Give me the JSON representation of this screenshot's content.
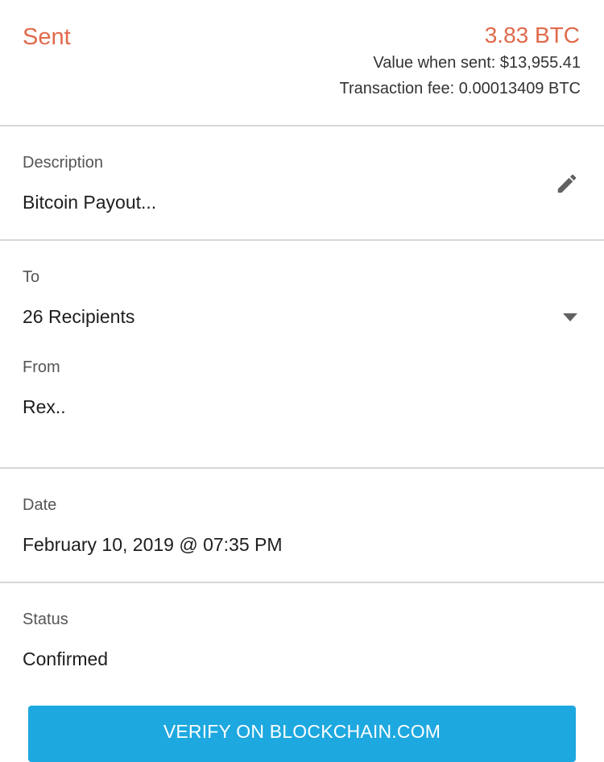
{
  "colors": {
    "sent_accent": "#e06a4c",
    "button_background": "#1ea8e0",
    "icon_gray": "#616161"
  },
  "summary": {
    "direction_label": "Sent",
    "amount": "3.83 BTC",
    "value_when_sent": "Value when sent: $13,955.41",
    "transaction_fee": "Transaction fee: 0.00013409 BTC"
  },
  "description": {
    "label": "Description",
    "value": "Bitcoin Payout...",
    "edit_icon": "pencil-icon"
  },
  "recipients": {
    "to_label": "To",
    "to_value": "26 Recipients",
    "dropdown_icon": "caret-down-icon",
    "from_label": "From",
    "from_value": "Rex.."
  },
  "date": {
    "label": "Date",
    "value": "February 10, 2019 @ 07:35 PM"
  },
  "status": {
    "label": "Status",
    "value": "Confirmed"
  },
  "actions": {
    "verify_label": "VERIFY ON BLOCKCHAIN.COM"
  }
}
